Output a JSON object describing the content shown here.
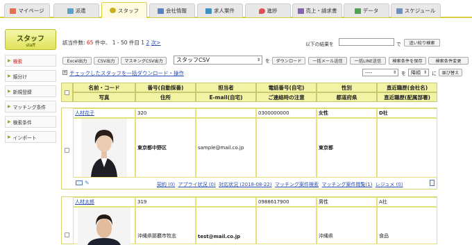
{
  "tabs": [
    {
      "label": "マイページ",
      "color": "#e07050"
    },
    {
      "label": "派遣",
      "color": "#5aa0c8"
    },
    {
      "label": "スタッフ",
      "color": "#c8b020"
    },
    {
      "label": "会社情報",
      "color": "#5a80c0"
    },
    {
      "label": "求人案件",
      "color": "#4090c0"
    },
    {
      "label": "進捗",
      "color": "#e05050"
    },
    {
      "label": "売上・請求書",
      "color": "#8a60b0"
    },
    {
      "label": "データ",
      "color": "#50a050"
    },
    {
      "label": "スケジュール",
      "color": "#7090c0"
    }
  ],
  "sidebar": {
    "logo": "スタッフ",
    "logo_sub": "staff",
    "items": [
      "検索",
      "振分け",
      "新規登録",
      "マッチング条件",
      "検索条件",
      "インポート"
    ]
  },
  "results": {
    "prefix": "該当件数: ",
    "count": "65",
    "mid": " 件中、 1 - 50 件目 ",
    "page1": "1",
    "page2": "2",
    "next": "次>"
  },
  "refine": {
    "label": "以下の結果を",
    "suffix": "で",
    "button": "追い絞り検索"
  },
  "toolbar": {
    "excel": "Excel出力",
    "csv": "CSV出力",
    "masking": "マスキングCSV出力",
    "csv_select": "スタッフCSV",
    "wo": "を",
    "download": "ダウンロード",
    "bulk_mail": "一括メール送信",
    "bulk_line": "一括LINE送信",
    "save_cond": "検索条件を保存",
    "change_cond": "検索条件変更"
  },
  "bulk_link": "チェックしたスタッフを一括ダウンロード・操作",
  "sort": {
    "select1": "----",
    "wo": "を",
    "select2": "降順",
    "ni": "に",
    "button": "並び替え"
  },
  "headers": {
    "row1": [
      "名前・コード",
      "番号(自動採番)",
      "担当者",
      "電話番号(自宅)",
      "性別",
      "直近職歴(会社名)"
    ],
    "row2": [
      "写真",
      "住所",
      "E-mail(自宅)",
      "ご連絡時の注意",
      "都道府県",
      "直近職歴(配属部署)"
    ]
  },
  "staff": [
    {
      "name": "人材花子",
      "code": "320",
      "phone": "0300000000",
      "gender": "女性",
      "company": "D社",
      "address": "東京都中野区",
      "email": "sample@mail.co.jp",
      "pref": "東京都",
      "dept": "",
      "actions": [
        "契約 (0)",
        "アプライ状況 (0)",
        "対応状況 (2018-08-22)",
        "マッチング案件検索",
        "マッチング案件閲覧(1)",
        "レジュメ (0)"
      ]
    },
    {
      "name": "人材太郎",
      "code": "319",
      "phone": "0988617900",
      "gender": "男性",
      "company": "A社",
      "address": "沖縄県那覇市牧志",
      "email": "test@mail.co.jp",
      "pref": "沖縄県",
      "dept": "食品"
    }
  ]
}
